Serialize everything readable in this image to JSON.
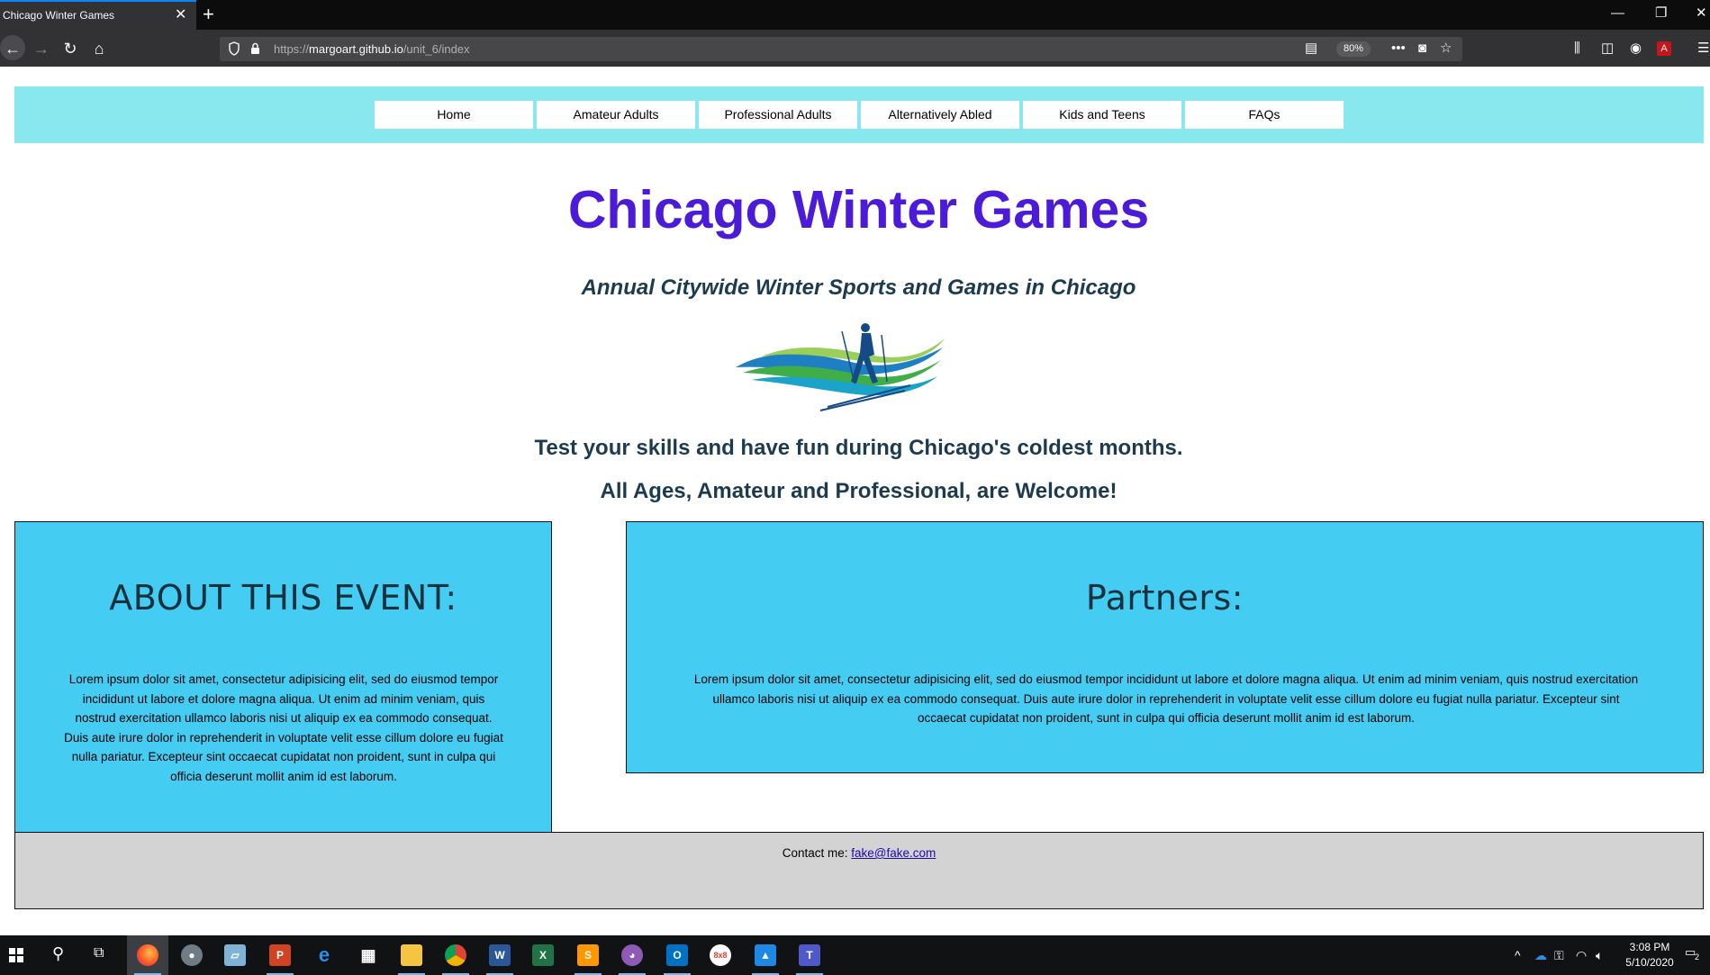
{
  "browser": {
    "tab_title": "Chicago Winter Games",
    "url_scheme": "https://",
    "url_host": "margoart.github.io",
    "url_path": "/unit_6/index",
    "zoom": "80%"
  },
  "page": {
    "nav": [
      "Home",
      "Amateur Adults",
      "Professional Adults",
      "Alternatively Abled",
      "Kids and Teens",
      "FAQs"
    ],
    "title": "Chicago Winter Games",
    "subtitle": "Annual Citywide Winter Sports and Games in Chicago",
    "tagline1": "Test your skills and have fun during Chicago's coldest months.",
    "tagline2": "All Ages, Amateur and Professional, are Welcome!",
    "about": {
      "heading": "ABOUT THIS EVENT:",
      "body": "Lorem ipsum dolor sit amet, consectetur adipisicing elit, sed do eiusmod tempor incididunt ut labore et dolore magna aliqua. Ut enim ad minim veniam, quis nostrud exercitation ullamco laboris nisi ut aliquip ex ea commodo consequat. Duis aute irure dolor in reprehenderit in voluptate velit esse cillum dolore eu fugiat nulla pariatur. Excepteur sint occaecat cupidatat non proident, sunt in culpa qui officia deserunt mollit anim id est laborum."
    },
    "partners": {
      "heading": "Partners:",
      "body": "Lorem ipsum dolor sit amet, consectetur adipisicing elit, sed do eiusmod tempor incididunt ut labore et dolore magna aliqua. Ut enim ad minim veniam, quis nostrud exercitation ullamco laboris nisi ut aliquip ex ea commodo consequat. Duis aute irure dolor in reprehenderit in voluptate velit esse cillum dolore eu fugiat nulla pariatur. Excepteur sint occaecat cupidatat non proident, sunt in culpa qui officia deserunt mollit anim id est laborum."
    },
    "footer": {
      "label": "Contact me:",
      "email": "fake@fake.com"
    }
  },
  "taskbar": {
    "time": "3:08 PM",
    "date": "5/10/2020",
    "notification_count": "2",
    "apps": [
      "firefox",
      "paint",
      "notepad",
      "powerpoint",
      "edge",
      "calculator",
      "file-explorer",
      "chrome",
      "word",
      "excel",
      "sublime-text",
      "github-desktop",
      "outlook",
      "8x8",
      "photos",
      "teams"
    ]
  },
  "colors": {
    "title": "#4b1bd8",
    "nav_bg": "#88e8ee",
    "box_bg": "#44ccf2",
    "footer_bg": "#d3d3d3",
    "text_dark": "#1d3b50"
  }
}
